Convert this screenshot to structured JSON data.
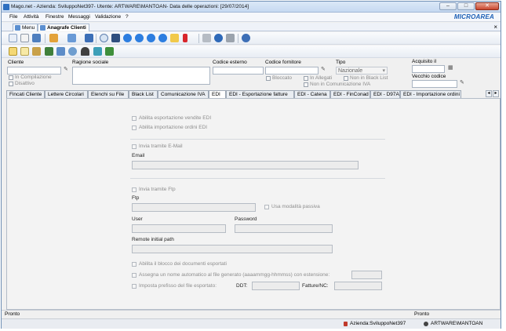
{
  "window": {
    "title": "Mago.net - Azienda: SviluppoNet397- Utente: ARTWARE\\MANTOAN- Data delle operazioni: [29/07/2014]",
    "minimize": "–",
    "maximize": "□",
    "close": "✕"
  },
  "menu": {
    "items": [
      "File",
      "Attività",
      "Finestre",
      "Messaggi",
      "Validazione",
      "?"
    ],
    "logo": "MICROAREA"
  },
  "doc_tabs": [
    {
      "label": "Menu"
    },
    {
      "label": "Anagrafe Clienti"
    }
  ],
  "doc_tab_close": "×",
  "header": {
    "cliente_label": "Cliente",
    "ragione_label": "Ragione sociale",
    "codice_esterno_label": "Codice esterno",
    "codice_fornitore_label": "Codice fornitore",
    "tipo_label": "Tipo",
    "tipo_value": "Nazionale",
    "acquisito_label": "Acquisito il",
    "vecchio_codice_label": "Vecchio codice",
    "in_compilazione": "In Compilazione",
    "disattivo": "Disattivo",
    "bloccato": "Bloccato",
    "in_allegati": "In Allegati",
    "non_in_black_list": "Non in Black List",
    "non_in_comunicazione_iva": "Non in Comunicazione IVA"
  },
  "tabs": [
    "Fincati Cliente",
    "Lettere Circolari",
    "Elenchi su File",
    "Black List",
    "Comunicazione IVA",
    "EDI",
    "EDI - Esportazione fatture",
    "EDI - Catena",
    "EDI - FinConad",
    "EDI - D97A",
    "EDI - Importazione ordini"
  ],
  "tab_scroll": {
    "left": "◂",
    "right": "▸"
  },
  "edi": {
    "abilita_esportazione": "Abilita esportazione vendite EDI",
    "abilita_importazione": "Abilita importazione ordini EDI",
    "invia_email": "Invia tramite E-Mail",
    "email_label": "Email",
    "invia_ftp": "Invia tramite Ftp",
    "ftp_label": "Ftp",
    "passiva": "Usa modalità passiva",
    "user_label": "User",
    "password_label": "Password",
    "remote_path_label": "Remote initial path",
    "blocco": "Abilita il blocco dei documenti esportati",
    "nome_automatico": "Assegna un nome automatico al file generato (aaaammgg-hhmmss) con estensione:",
    "prefisso": "Imposta prefisso del file esportato:",
    "ddt_label": "DDT:",
    "fatture_label": "Fatture/NC:"
  },
  "status": {
    "left": "Pronto",
    "right": "Pronto",
    "azienda": "Azienda:SviluppoNet397",
    "utente": "ARTWARE\\MANTOAN"
  }
}
